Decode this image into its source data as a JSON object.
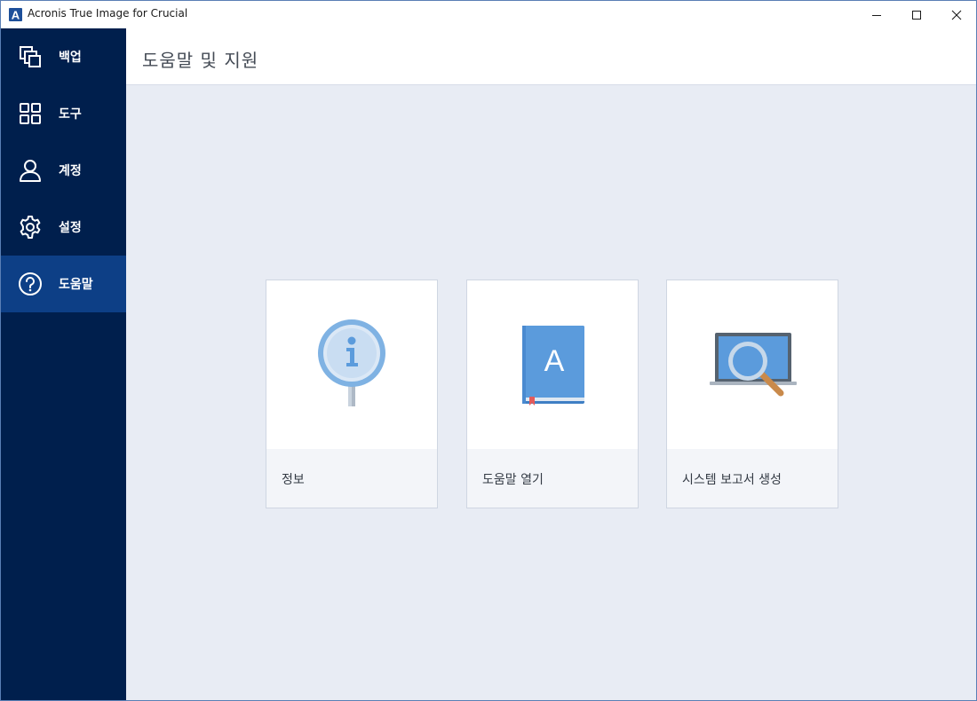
{
  "window": {
    "title": "Acronis True Image for Crucial",
    "logo_letter": "A"
  },
  "sidebar": {
    "items": [
      {
        "label": "백업",
        "icon": "backup-icon"
      },
      {
        "label": "도구",
        "icon": "tools-grid-icon"
      },
      {
        "label": "계정",
        "icon": "account-icon"
      },
      {
        "label": "설정",
        "icon": "settings-gear-icon"
      },
      {
        "label": "도움말",
        "icon": "help-question-icon",
        "active": true
      }
    ]
  },
  "main": {
    "title": "도움말 및 지원",
    "cards": [
      {
        "label": "정보",
        "icon": "info-sign-icon"
      },
      {
        "label": "도움말 열기",
        "icon": "help-book-icon",
        "book_letter": "A"
      },
      {
        "label": "시스템 보고서 생성",
        "icon": "system-report-magnifier-icon"
      }
    ]
  },
  "colors": {
    "sidebar_bg": "#001f4d",
    "sidebar_active": "#0d3f86",
    "main_bg": "#e8ecf4",
    "accent_blue": "#5b9bdc"
  }
}
